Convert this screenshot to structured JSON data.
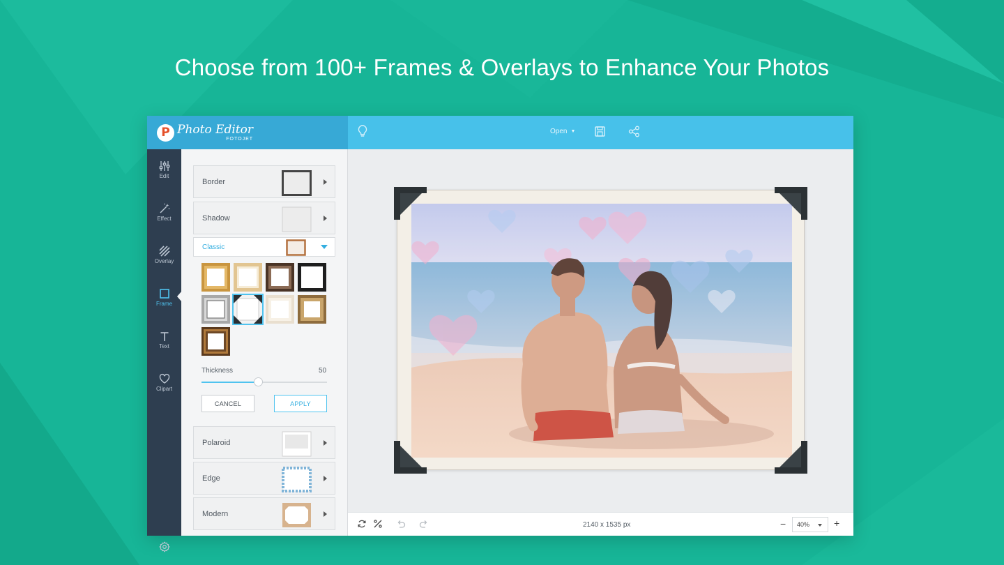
{
  "headline": "Choose from 100+ Frames & Overlays to Enhance Your Photos",
  "colors": {
    "background": "#17b597",
    "brand_bar": "#37a9d6",
    "top_bar": "#47c1ea",
    "side_nav": "#2e3e50",
    "accent": "#4fc3ef"
  },
  "brand": {
    "logo_letter": "P",
    "name": "Photo Editor",
    "sub": "FOTOJET"
  },
  "toolbar": {
    "open_label": "Open",
    "icons": [
      "lightbulb-icon",
      "save-icon",
      "share-icon"
    ]
  },
  "nav": [
    {
      "label": "Edit",
      "icon": "sliders-icon"
    },
    {
      "label": "Effect",
      "icon": "magic-wand-icon"
    },
    {
      "label": "Overlay",
      "icon": "stripes-icon"
    },
    {
      "label": "Frame",
      "icon": "square-icon",
      "active": true
    },
    {
      "label": "Text",
      "icon": "text-t-icon"
    },
    {
      "label": "Clipart",
      "icon": "heart-icon"
    }
  ],
  "panel": {
    "border_label": "Border",
    "shadow_label": "Shadow",
    "classic_label": "Classic",
    "thickness_label": "Thickness",
    "thickness_value": "50",
    "thickness_fraction": 0.45,
    "cancel_label": "CANCEL",
    "apply_label": "APPLY",
    "polaroid_label": "Polaroid",
    "edge_label": "Edge",
    "modern_label": "Modern",
    "selected_swatch_index": 5
  },
  "status": {
    "dimensions": "2140 x 1535 px",
    "zoom": "40%"
  }
}
